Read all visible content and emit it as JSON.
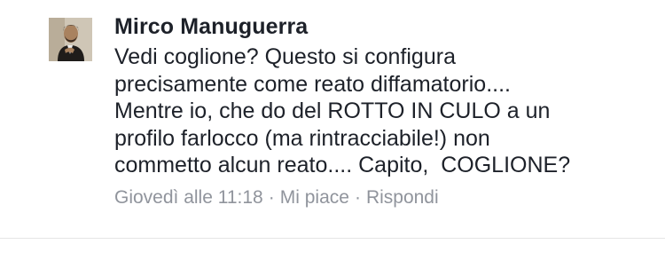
{
  "comment": {
    "author": "Mirco Manuguerra",
    "body_lines": [
      "Vedi coglione? Questo si configura",
      "precisamente come reato diffamatorio....",
      "Mentre io, che do del ROTTO IN CULO a un",
      "profilo farlocco (ma rintracciabile!) non",
      "commetto alcun reato.... Capito,  COGLIONE?"
    ],
    "timestamp": "Giovedì alle 11:18",
    "separator": "·",
    "like_label": "Mi piace",
    "reply_label": "Rispondi"
  },
  "colors": {
    "text": "#1d2129",
    "meta": "#90949c",
    "divider": "#e5e5e5"
  }
}
